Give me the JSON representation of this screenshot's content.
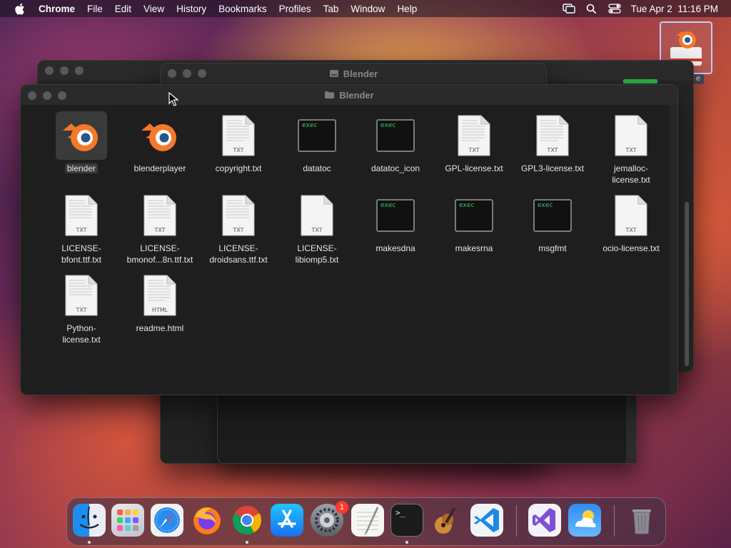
{
  "menubar": {
    "app_name": "Chrome",
    "items": [
      "File",
      "Edit",
      "View",
      "History",
      "Bookmarks",
      "Profiles",
      "Tab",
      "Window",
      "Help"
    ],
    "clock": "Tue Apr 2  11:16 PM"
  },
  "windows": {
    "back_title": "Blender",
    "front_title": "Blender"
  },
  "files": [
    {
      "name": "blender",
      "kind": "app"
    },
    {
      "name": "blenderplayer",
      "kind": "app"
    },
    {
      "name": "copyright.txt",
      "kind": "txt",
      "badge": "TXT"
    },
    {
      "name": "datatoc",
      "kind": "exec",
      "badge": "exec"
    },
    {
      "name": "datatoc_icon",
      "kind": "exec",
      "badge": "exec"
    },
    {
      "name": "GPL-license.txt",
      "kind": "txt",
      "badge": "TXT"
    },
    {
      "name": "GPL3-license.txt",
      "kind": "txt",
      "badge": "TXT"
    },
    {
      "name": "jemalloc-license.txt",
      "kind": "txt",
      "badge": "TXT"
    },
    {
      "name": "LICENSE-bfont.ttf.txt",
      "kind": "txt",
      "badge": "TXT"
    },
    {
      "name": "LICENSE-bmonof...8n.ttf.txt",
      "kind": "txt",
      "badge": "TXT"
    },
    {
      "name": "LICENSE-droidsans.ttf.txt",
      "kind": "txt",
      "badge": "TXT"
    },
    {
      "name": "LICENSE-libiomp5.txt",
      "kind": "txt",
      "badge": "TXT"
    },
    {
      "name": "makesdna",
      "kind": "exec",
      "badge": "exec"
    },
    {
      "name": "makesrna",
      "kind": "exec",
      "badge": "exec"
    },
    {
      "name": "msgfmt",
      "kind": "exec",
      "badge": "exec"
    },
    {
      "name": "ocio-license.txt",
      "kind": "txt",
      "badge": "TXT"
    },
    {
      "name": "Python-license.txt",
      "kind": "txt",
      "badge": "TXT"
    },
    {
      "name": "readme.html",
      "kind": "txt",
      "badge": "HTML"
    }
  ],
  "selected_file": "blender",
  "labels": {
    "f0": "blender",
    "f1": "blenderplayer",
    "f2": "copyright.txt",
    "f3": "datatoc",
    "f4": "datatoc_icon",
    "f5": "GPL-license.txt",
    "f6": "GPL3-license.txt",
    "f7a": "jemalloc-",
    "f7b": "license.txt",
    "f8a": "LICENSE-",
    "f8b": "bfont.ttf.txt",
    "f9a": "LICENSE-",
    "f9b": "bmonof...8n.ttf.txt",
    "f10a": "LICENSE-",
    "f10b": "droidsans.ttf.txt",
    "f11a": "LICENSE-",
    "f11b": "libiomp5.txt",
    "f12": "makesdna",
    "f13": "makesrna",
    "f14": "msgfmt",
    "f15": "ocio-license.txt",
    "f16a": "Python-",
    "f16b": "license.txt",
    "f17": "readme.html"
  },
  "badges": {
    "txt": "TXT",
    "exec": "exec",
    "html": "HTML"
  },
  "dock": {
    "apps": [
      "Finder",
      "Launchpad",
      "Safari",
      "Firefox",
      "Google Chrome",
      "App Store",
      "System Settings",
      "TextEdit",
      "Terminal",
      "GarageBand",
      "Visual Studio Code",
      "Visual Studio",
      "Weather",
      "Trash"
    ],
    "settings_badge": "1",
    "terminal_prompt": ">_"
  },
  "colors": {
    "accent_orange": "#f5792a",
    "blender_blue": "#265787",
    "exec_green": "#3fc86b",
    "badge_red": "#ff3b30"
  }
}
